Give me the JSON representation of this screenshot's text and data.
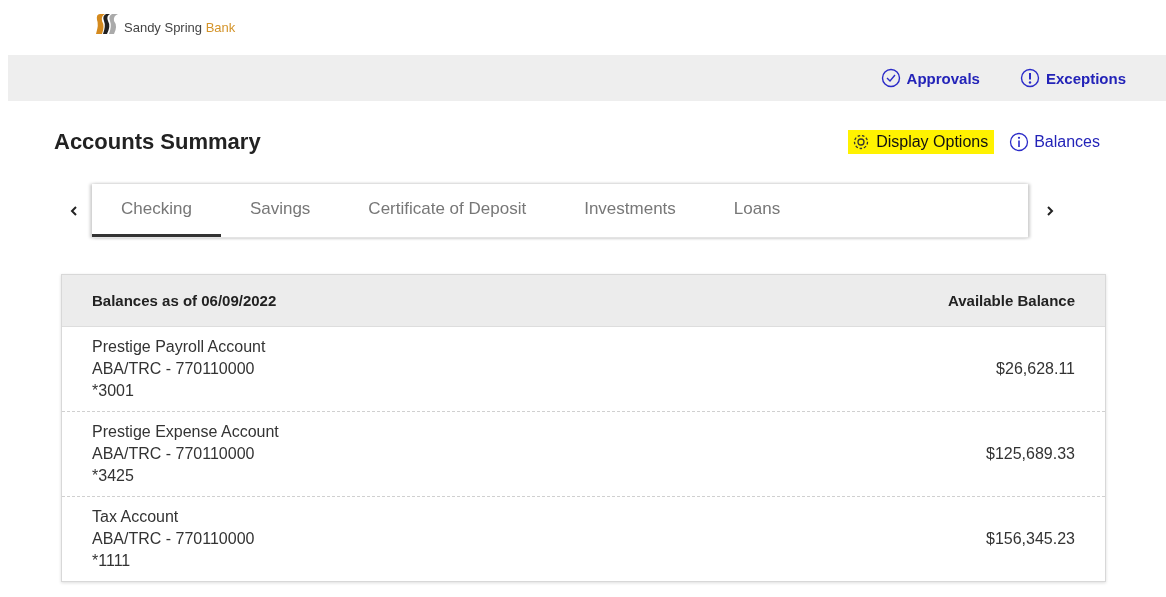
{
  "brand": {
    "name": "Sandy Spring",
    "accent": "Bank"
  },
  "top_bar": {
    "links": [
      {
        "kind": "check",
        "label": "Approvals"
      },
      {
        "kind": "alert",
        "label": "Exceptions"
      }
    ]
  },
  "page_title": "Accounts Summary",
  "actions": [
    {
      "kind": "gear",
      "label": "Display Options",
      "highlighted": true
    },
    {
      "kind": "info",
      "label": "Balances",
      "highlighted": false
    }
  ],
  "tabs": [
    {
      "label": "Checking",
      "selected": true
    },
    {
      "label": "Savings",
      "selected": false
    },
    {
      "label": "Certificate of Deposit",
      "selected": false
    },
    {
      "label": "Investments",
      "selected": false
    },
    {
      "label": "Loans",
      "selected": false
    }
  ],
  "table": {
    "columns": [
      "Balances as of 06/09/2022",
      "Available Balance"
    ],
    "rows": [
      {
        "name": "Prestige Payroll Account",
        "routing": "ABA/TRC - 770110000",
        "number": "*3001",
        "balance": "$26,628.11"
      },
      {
        "name": "Prestige Expense Account",
        "routing": "ABA/TRC - 770110000",
        "number": "*3425",
        "balance": "$125,689.33"
      },
      {
        "name": "Tax Account",
        "routing": "ABA/TRC - 770110000",
        "number": "*1111",
        "balance": "$156,345.23"
      }
    ]
  }
}
